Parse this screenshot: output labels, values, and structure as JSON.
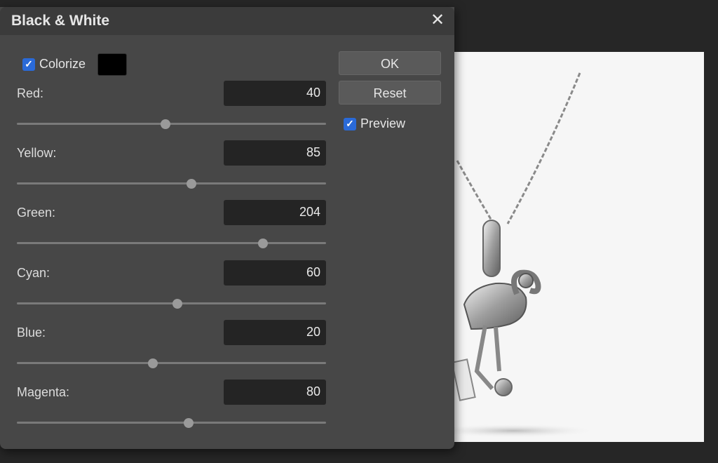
{
  "dialog": {
    "title": "Black & White",
    "close_glyph": "✕",
    "colorize": {
      "label": "Colorize",
      "checked": true,
      "color": "#000000"
    },
    "preview": {
      "label": "Preview",
      "checked": true
    },
    "buttons": {
      "ok": "OK",
      "reset": "Reset"
    },
    "channels": [
      {
        "label": "Red:",
        "value": "40",
        "slider_fraction": 0.48
      },
      {
        "label": "Yellow:",
        "value": "85",
        "slider_fraction": 0.565
      },
      {
        "label": "Green:",
        "value": "204",
        "slider_fraction": 0.795
      },
      {
        "label": "Cyan:",
        "value": "60",
        "slider_fraction": 0.52
      },
      {
        "label": "Blue:",
        "value": "20",
        "slider_fraction": 0.44
      },
      {
        "label": "Magenta:",
        "value": "80",
        "slider_fraction": 0.555
      }
    ]
  },
  "canvas": {
    "image_subject": "silver flamingo pendant necklace",
    "background_color": "#f6f6f6"
  },
  "icons": {
    "checkmark": "✓",
    "close": "close-icon"
  }
}
